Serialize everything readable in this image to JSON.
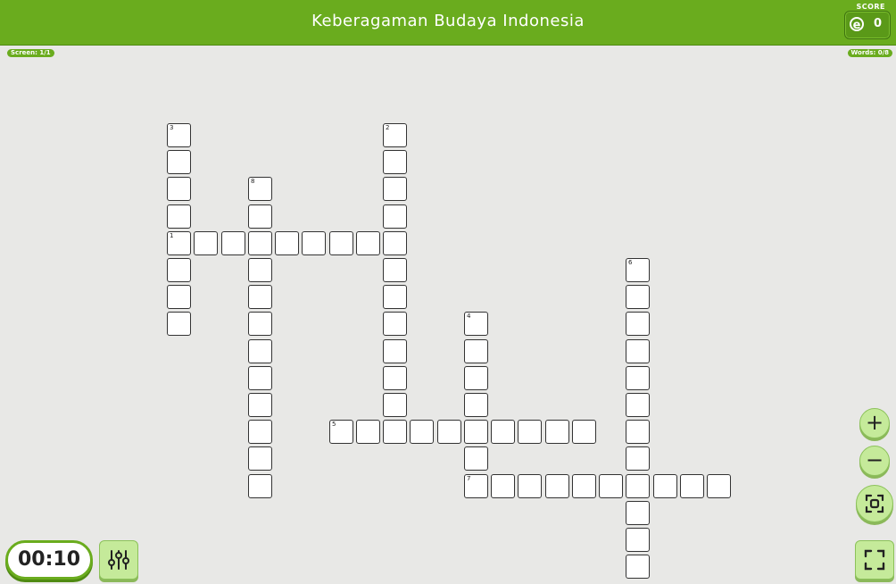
{
  "header": {
    "title": "Keberagaman Budaya Indonesia",
    "score_label": "SCORE",
    "score_icon": "e-coin-icon",
    "score_value": "0"
  },
  "status": {
    "screen": "Screen: 1/1",
    "words": "Words: 0/8"
  },
  "timer": "00:10",
  "controls": {
    "zoom_in": "+",
    "zoom_out": "−"
  },
  "colors": {
    "brand_green": "#6aac1e",
    "button_green": "#c5ea9a",
    "background": "#e8e8e6"
  },
  "puzzle": {
    "words": [
      {
        "number": "1",
        "direction": "across",
        "row": 4,
        "col": 0,
        "length": 9
      },
      {
        "number": "2",
        "direction": "down",
        "row": 0,
        "col": 8,
        "length": 11
      },
      {
        "number": "3",
        "direction": "down",
        "row": 0,
        "col": 0,
        "length": 8
      },
      {
        "number": "4",
        "direction": "down",
        "row": 7,
        "col": 11,
        "length": 6
      },
      {
        "number": "5",
        "direction": "across",
        "row": 11,
        "col": 6,
        "length": 10
      },
      {
        "number": "6",
        "direction": "down",
        "row": 5,
        "col": 17,
        "length": 12
      },
      {
        "number": "7",
        "direction": "across",
        "row": 13,
        "col": 11,
        "length": 10
      },
      {
        "number": "8",
        "direction": "down",
        "row": 2,
        "col": 3,
        "length": 12
      }
    ]
  }
}
